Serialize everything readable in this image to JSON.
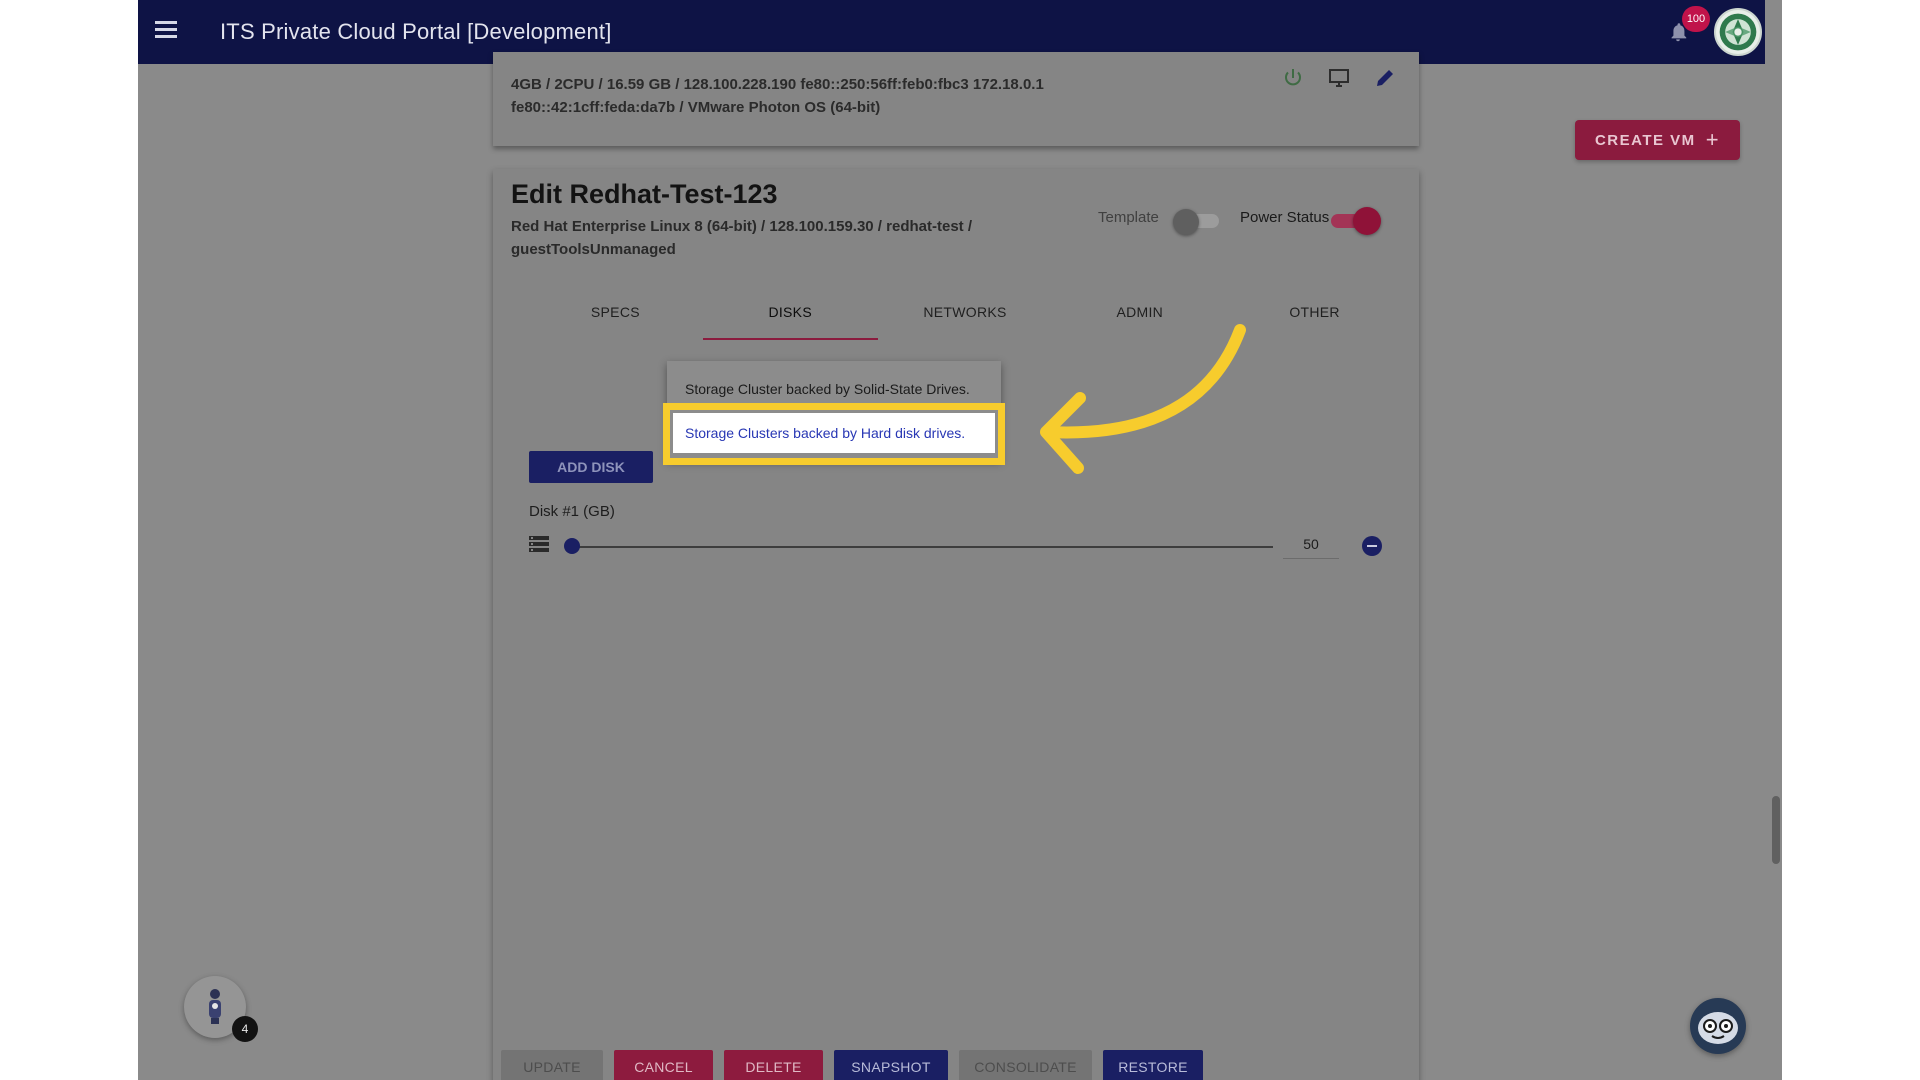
{
  "app": {
    "title": "ITS Private Cloud Portal [Development]",
    "notification_count": "100"
  },
  "actions": {
    "create_vm_label": "CREATE VM",
    "create_vm_icon": "+"
  },
  "prev_vm": {
    "line1": "4GB / 2CPU / 16.59 GB / 128.100.228.190 fe80::250:56ff:feb0:fbc3 172.18.0.1",
    "line2": "fe80::42:1cff:feda:da7b / VMware Photon OS (64-bit)",
    "icons": [
      "power-icon",
      "console-icon",
      "edit-icon"
    ]
  },
  "edit_vm": {
    "title": "Edit Redhat-Test-123",
    "subtitle": "Red Hat Enterprise Linux 8 (64-bit) / 128.100.159.30 / redhat-test / guestToolsUnmanaged",
    "template_label": "Template",
    "template_on": false,
    "power_label": "Power Status",
    "power_on": true,
    "tabs": [
      {
        "label": "SPECS",
        "active": false
      },
      {
        "label": "DISKS",
        "active": true
      },
      {
        "label": "NETWORKS",
        "active": false
      },
      {
        "label": "ADMIN",
        "active": false
      },
      {
        "label": "OTHER",
        "active": false
      }
    ],
    "add_disk_label": "ADD DISK",
    "disk": {
      "label": "Disk #1 (GB)",
      "value": "50"
    },
    "dropdown_options": [
      "Storage Cluster backed by Solid-State Drives.",
      "Storage Clusters backed by Hard disk drives."
    ],
    "buttons": {
      "update": "UPDATE",
      "cancel": "CANCEL",
      "delete": "DELETE",
      "snapshot": "SNAPSHOT",
      "consolidate": "CONSOLIDATE",
      "restore": "RESTORE"
    }
  },
  "floating": {
    "assistant_badge": "4"
  },
  "colors": {
    "appbar": "#0e1345",
    "accent_red": "#8b1b3e",
    "accent_navy": "#1a1f63",
    "highlight_yellow": "#f7cc2d",
    "link_blue": "#2837b4"
  }
}
